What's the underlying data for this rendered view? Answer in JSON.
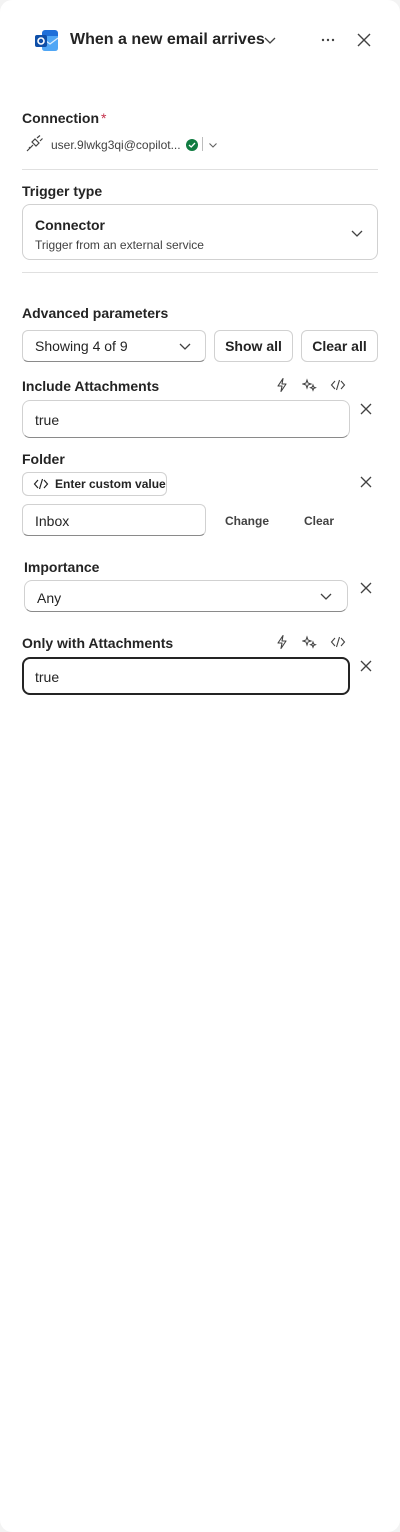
{
  "header": {
    "title": "When a new email arrives",
    "icon": "outlook-icon"
  },
  "connection": {
    "label": "Connection",
    "required_mark": "*",
    "account": "user.9lwkg3qi@copilot...",
    "status_color": "#107c41"
  },
  "trigger_type": {
    "label": "Trigger type",
    "title": "Connector",
    "subtitle": "Trigger from an external service"
  },
  "advanced": {
    "label": "Advanced parameters",
    "showing": "Showing 4 of 9",
    "show_all": "Show all",
    "clear_all": "Clear all"
  },
  "params": {
    "include_attachments": {
      "label": "Include Attachments",
      "value": "true"
    },
    "folder": {
      "label": "Folder",
      "custom_value_label": "Enter custom value",
      "value": "Inbox",
      "change_label": "Change",
      "clear_label": "Clear"
    },
    "importance": {
      "label": "Importance",
      "value": "Any"
    },
    "only_with_attachments": {
      "label": "Only with Attachments",
      "value": "true"
    }
  },
  "colors": {
    "text": "#242424",
    "border": "#d1d1d1",
    "required": "#c4314b",
    "check": "#107c41"
  }
}
